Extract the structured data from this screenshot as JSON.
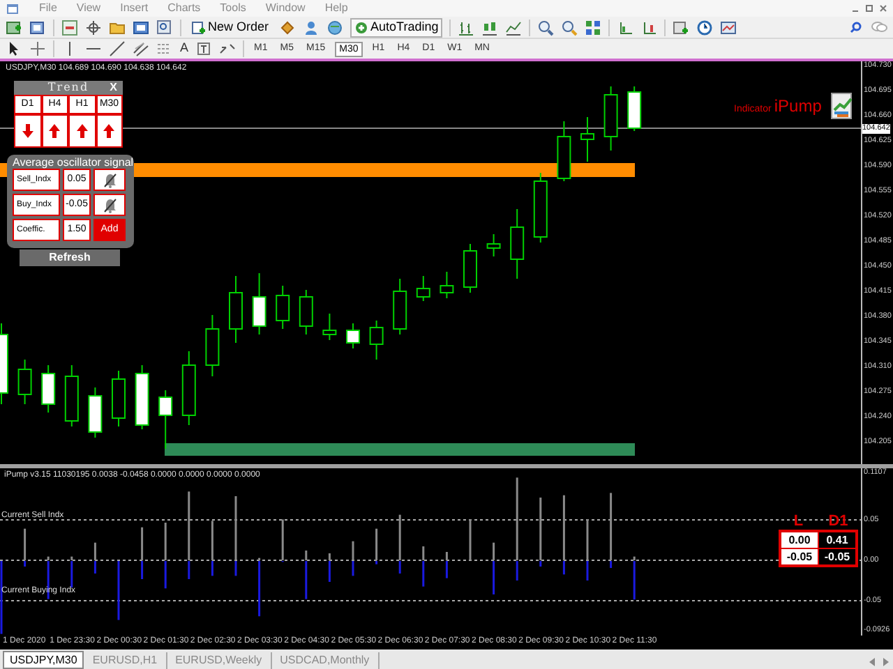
{
  "menu_bar": [
    "File",
    "View",
    "Insert",
    "Charts",
    "Tools",
    "Window",
    "Help"
  ],
  "toolbar": {
    "new_order": "New Order",
    "auto_trading": "AutoTrading",
    "text_tool": "A"
  },
  "timeframes": [
    {
      "label": "M1",
      "selected": false
    },
    {
      "label": "M5",
      "selected": false
    },
    {
      "label": "M15",
      "selected": false
    },
    {
      "label": "M30",
      "selected": true
    },
    {
      "label": "H1",
      "selected": false
    },
    {
      "label": "H4",
      "selected": false
    },
    {
      "label": "D1",
      "selected": false
    },
    {
      "label": "W1",
      "selected": false
    },
    {
      "label": "MN",
      "selected": false
    }
  ],
  "chart": {
    "title": "USDJPY,M30  104.689 104.690 104.638 104.642",
    "price_axis": [
      "104.730",
      "104.695",
      "104.660",
      "104.625",
      "104.590",
      "104.555",
      "104.520",
      "104.485",
      "104.450",
      "104.415",
      "104.380",
      "104.345",
      "104.310",
      "104.275",
      "104.240",
      "104.205"
    ],
    "current_price": "104.642",
    "brand_prefix": "Indicator",
    "brand_name": "iPump"
  },
  "trend_panel": {
    "title": "Trend",
    "close": "X",
    "columns": [
      {
        "label": "D1",
        "kind": "down"
      },
      {
        "label": "H4",
        "kind": "up"
      },
      {
        "label": "H1",
        "kind": "up"
      },
      {
        "label": "M30",
        "kind": "up"
      }
    ]
  },
  "signal_panel": {
    "title": "Average oscillator signal",
    "rows": [
      {
        "kind": "alert",
        "label": "Sell_Indx",
        "value": "0.05"
      },
      {
        "kind": "alert",
        "label": "Buy_Indx",
        "value": "-0.05"
      },
      {
        "kind": "button",
        "label": "Coeffic.",
        "value": "1.50",
        "button": "Add"
      }
    ]
  },
  "refresh_button": "Refresh",
  "indicator": {
    "title": "iPump v3.15 11030195 0.0038 -0.0458 0.0000 0.0000 0.0000 0.0000",
    "sell_level": "Current Sell Indx",
    "buy_level": "Current Buying Indx",
    "axis": [
      "0.1107",
      "0.05",
      "0.00",
      "-0.05",
      "-0.0926"
    ],
    "table": {
      "headers": [
        "L",
        "D1"
      ],
      "rows": [
        [
          "0.00",
          "0.41"
        ],
        [
          "-0.05",
          "-0.05"
        ]
      ]
    }
  },
  "time_axis": [
    "1 Dec 2020",
    "1 Dec 23:30",
    "2 Dec 00:30",
    "2 Dec 01:30",
    "2 Dec 02:30",
    "2 Dec 03:30",
    "2 Dec 04:30",
    "2 Dec 05:30",
    "2 Dec 06:30",
    "2 Dec 07:30",
    "2 Dec 08:30",
    "2 Dec 09:30",
    "2 Dec 10:30",
    "2 Dec 11:30"
  ],
  "tabs": [
    {
      "label": "USDJPY,M30",
      "selected": true
    },
    {
      "label": "EURUSD,H1",
      "selected": false
    },
    {
      "label": "EURUSD,Weekly",
      "selected": false
    },
    {
      "label": "USDCAD,Monthly",
      "selected": false
    }
  ]
}
